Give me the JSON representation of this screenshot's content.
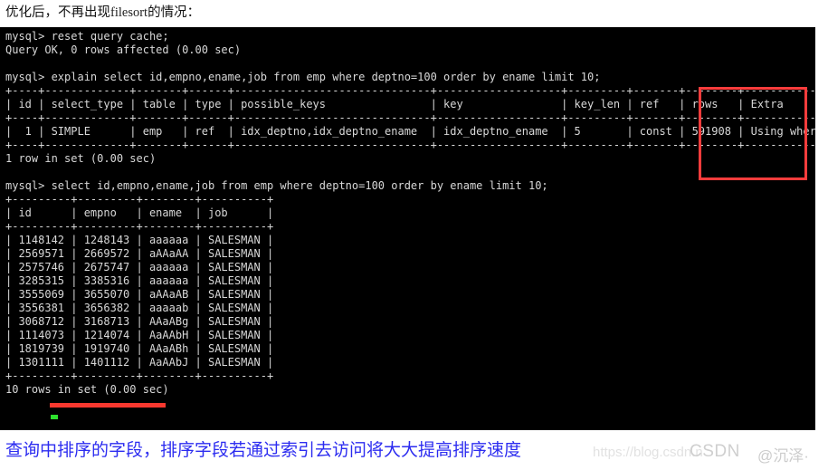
{
  "top_caption": {
    "prefix": "优化后，不再出现",
    "keyword": "filesort",
    "suffix": "的情况："
  },
  "bottom_caption": {
    "text": "查询中排序的字段，排序字段若通过索引去访问将大大提高排序速度"
  },
  "watermark": {
    "url": "https://blog.csdn.n",
    "brand": "CSDN",
    "handle": "@沉泽·"
  },
  "terminal": {
    "background": "#000000",
    "foreground": "#d8d8d8",
    "prompt": "mysql>",
    "commands": [
      "reset query cache;",
      "explain select id,empno,ename,job from emp where deptno=100 order by ename limit 10;",
      "select id,empno,ename,job from emp where deptno=100 order by ename limit 10;"
    ],
    "status_lines": [
      "Query OK, 0 rows affected (0.00 sec)",
      "1 row in set (0.00 sec)",
      "10 rows in set (0.00 sec)"
    ],
    "explain_table": {
      "columns": [
        "id",
        "select_type",
        "table",
        "type",
        "possible_keys",
        "key",
        "key_len",
        "ref",
        "rows",
        "Extra"
      ],
      "widths": [
        4,
        13,
        7,
        6,
        30,
        19,
        9,
        7,
        8,
        13
      ],
      "rows": [
        [
          "1",
          "SIMPLE",
          "emp",
          "ref",
          "idx_deptno,idx_deptno_ename",
          "idx_deptno_ename",
          "5",
          "const",
          "591908",
          "Using where"
        ]
      ],
      "numeric_columns": [
        0,
        8
      ]
    },
    "result_table": {
      "columns": [
        "id",
        "empno",
        "ename",
        "job"
      ],
      "widths": [
        9,
        9,
        8,
        10
      ],
      "numeric_columns": [
        0,
        1
      ],
      "rows": [
        [
          "1148142",
          "1248143",
          "aaaaaa",
          "SALESMAN"
        ],
        [
          "2569571",
          "2669572",
          "aAAaAA",
          "SALESMAN"
        ],
        [
          "2575746",
          "2675747",
          "aaaaaa",
          "SALESMAN"
        ],
        [
          "3285315",
          "3385316",
          "aaaaaa",
          "SALESMAN"
        ],
        [
          "3555069",
          "3655070",
          "aAAaAB",
          "SALESMAN"
        ],
        [
          "3556381",
          "3656382",
          "aaaaab",
          "SALESMAN"
        ],
        [
          "3068712",
          "3168713",
          "AAaABg",
          "SALESMAN"
        ],
        [
          "1114073",
          "1214074",
          "AaAAbH",
          "SALESMAN"
        ],
        [
          "1819739",
          "1919740",
          "AAaABh",
          "SALESMAN"
        ],
        [
          "1301111",
          "1401112",
          "AaAAbJ",
          "SALESMAN"
        ]
      ]
    }
  },
  "annotations": {
    "extra_box_color": "#fa3c3c",
    "rows_underline_color": "#f8382f",
    "cursor_color": "#2ee02e"
  }
}
